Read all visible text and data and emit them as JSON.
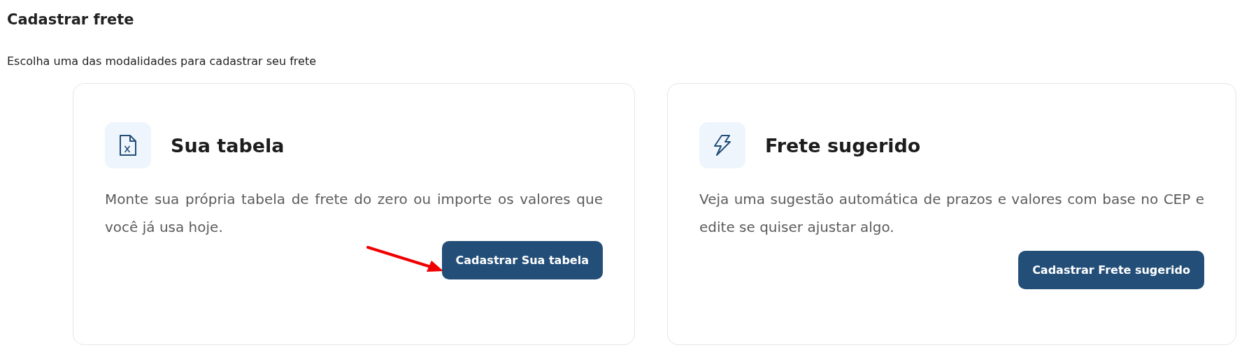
{
  "page": {
    "title": "Cadastrar frete",
    "subtitle": "Escolha uma das modalidades para cadastrar seu frete"
  },
  "cards": [
    {
      "kind": "table",
      "title": "Sua tabela",
      "description": "Monte sua própria tabela de frete do zero ou importe os valores que você já usa hoje.",
      "button": "Cadastrar Sua tabela",
      "pointer_arrow": true
    },
    {
      "kind": "suggested",
      "title": "Frete sugerido",
      "description": "Veja uma sugestão automática de prazos e valores com base no CEP e edite se quiser ajustar algo.",
      "button": "Cadastrar Frete sugerido",
      "pointer_arrow": false
    }
  ]
}
